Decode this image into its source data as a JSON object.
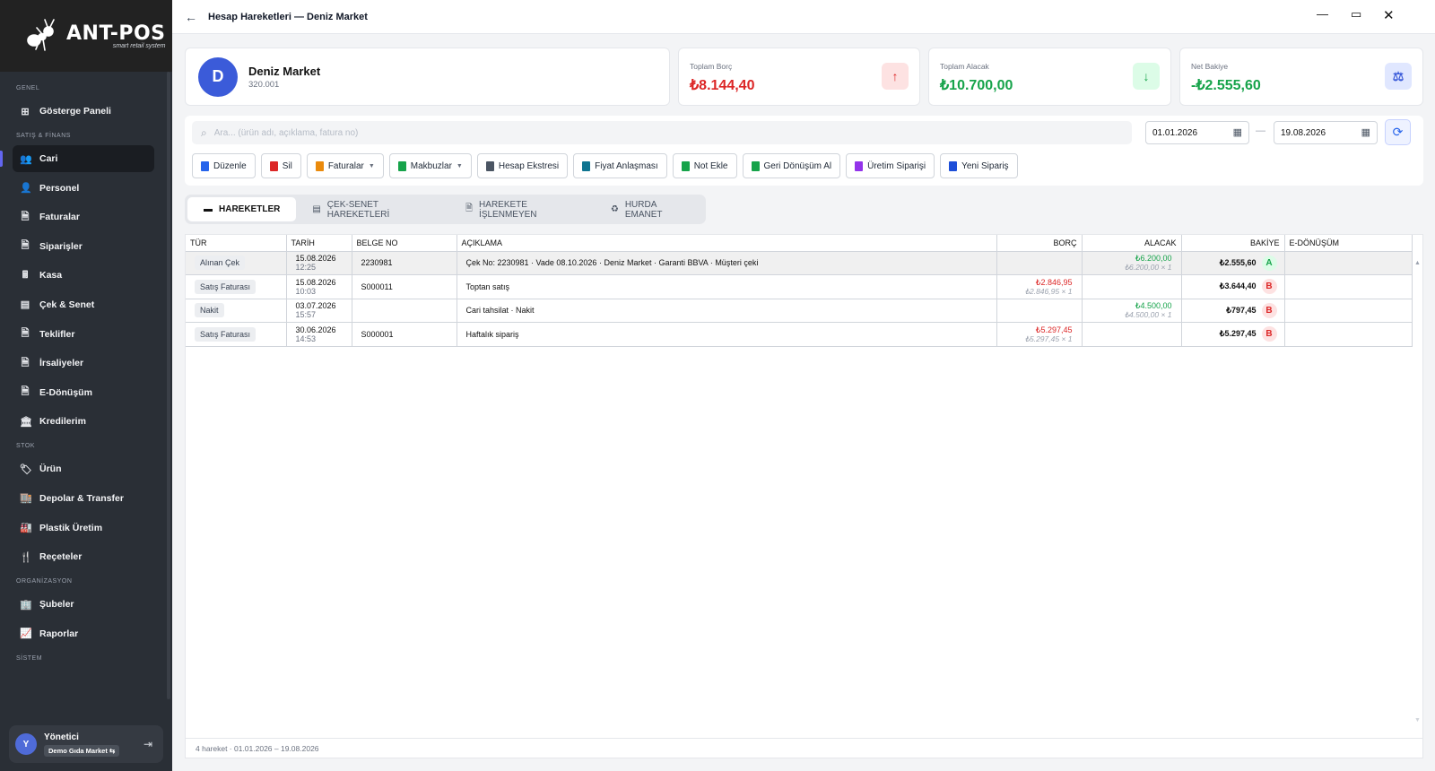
{
  "app": {
    "logo_name": "ANT-POS",
    "logo_tagline": "smart retail system"
  },
  "sidebar": {
    "sections": [
      {
        "label": "GENEL",
        "items": [
          {
            "label": "Gösterge Paneli",
            "icon": "dashboard-icon",
            "glyph": "⊞"
          }
        ]
      },
      {
        "label": "SATIŞ & FİNANS",
        "items": [
          {
            "label": "Cari",
            "icon": "users-icon",
            "glyph": "👥",
            "active": true
          },
          {
            "label": "Personel",
            "icon": "user-cog-icon",
            "glyph": "👤"
          },
          {
            "label": "Faturalar",
            "icon": "invoice-icon",
            "glyph": "🗎"
          },
          {
            "label": "Siparişler",
            "icon": "order-icon",
            "glyph": "🗎"
          },
          {
            "label": "Kasa",
            "icon": "cash-register-icon",
            "glyph": "🖩"
          },
          {
            "label": "Çek & Senet",
            "icon": "cheque-icon",
            "glyph": "▤"
          },
          {
            "label": "Teklifler",
            "icon": "offer-icon",
            "glyph": "🗎"
          },
          {
            "label": "İrsaliyeler",
            "icon": "waybill-icon",
            "glyph": "🗎"
          },
          {
            "label": "E-Dönüşüm",
            "icon": "e-invoice-icon",
            "glyph": "🗎"
          },
          {
            "label": "Kredilerim",
            "icon": "bank-icon",
            "glyph": "🏛"
          }
        ]
      },
      {
        "label": "STOK",
        "items": [
          {
            "label": "Ürün",
            "icon": "tag-icon",
            "glyph": "🏷"
          },
          {
            "label": "Depolar & Transfer",
            "icon": "warehouse-icon",
            "glyph": "🏬"
          },
          {
            "label": "Plastik Üretim",
            "icon": "factory-icon",
            "glyph": "🏭"
          },
          {
            "label": "Reçeteler",
            "icon": "utensils-icon",
            "glyph": "🍴"
          }
        ]
      },
      {
        "label": "ORGANİZASYON",
        "items": [
          {
            "label": "Şubeler",
            "icon": "branch-icon",
            "glyph": "🏢"
          },
          {
            "label": "Raporlar",
            "icon": "chart-line-icon",
            "glyph": "📈"
          }
        ]
      },
      {
        "label": "SİSTEM",
        "items": []
      }
    ],
    "user": {
      "initial": "Y",
      "name": "Yönetici",
      "company": "Demo Gıda Market",
      "switch_glyph": "⇆",
      "logout_glyph": "⇥"
    }
  },
  "topbar": {
    "title": "Hesap Hareketleri — Deniz Market",
    "back_glyph": "←",
    "min_glyph": "—",
    "max_glyph": "▭",
    "close_glyph": "✕"
  },
  "customer": {
    "initial": "D",
    "name": "Deniz Market",
    "code": "320.001"
  },
  "stats": {
    "debt": {
      "label": "Toplam Borç",
      "value": "₺8.144,40",
      "glyph": "↑",
      "color": "#dc2626"
    },
    "credit": {
      "label": "Toplam Alacak",
      "value": "₺10.700,00",
      "glyph": "↓",
      "color": "#16a34a"
    },
    "net": {
      "label": "Net Bakiye",
      "value": "-₺2.555,60",
      "glyph": "⚖",
      "color": "#16a34a"
    }
  },
  "search": {
    "placeholder": "Ara... (ürün adı, açıklama, fatura no)",
    "value": ""
  },
  "date_from": "01.01.2026",
  "date_to": "19.08.2026",
  "date_sep": "—",
  "refresh_glyph": "⟳",
  "calendar_glyph": "▦",
  "search_glyph": "⌕",
  "actions": [
    {
      "label": "Düzenle",
      "name": "edit-button",
      "icon": "edit-icon",
      "color": "#2563eb",
      "dd": false
    },
    {
      "label": "Sil",
      "name": "delete-button",
      "icon": "trash-icon",
      "color": "#dc2626",
      "dd": false
    },
    {
      "label": "Faturalar",
      "name": "invoices-button",
      "icon": "invoice-icon",
      "color": "#ea8a0c",
      "dd": true
    },
    {
      "label": "Makbuzlar",
      "name": "receipts-button",
      "icon": "receipt-icon",
      "color": "#16a34a",
      "dd": true
    },
    {
      "label": "Hesap Ekstresi",
      "name": "statement-button",
      "icon": "file-icon",
      "color": "#4b5563",
      "dd": false
    },
    {
      "label": "Fiyat Anlaşması",
      "name": "price-agreement-button",
      "icon": "handshake-icon",
      "color": "#0e7490",
      "dd": false
    },
    {
      "label": "Not Ekle",
      "name": "add-note-button",
      "icon": "note-icon",
      "color": "#16a34a",
      "dd": false
    },
    {
      "label": "Geri Dönüşüm Al",
      "name": "recycle-button",
      "icon": "recycle-icon",
      "color": "#16a34a",
      "dd": false
    },
    {
      "label": "Üretim Siparişi",
      "name": "production-order-button",
      "icon": "factory-icon",
      "color": "#9333ea",
      "dd": false
    },
    {
      "label": "Yeni Sipariş",
      "name": "new-order-button",
      "icon": "clipboard-icon",
      "color": "#1d4ed8",
      "dd": false
    }
  ],
  "tabs": [
    {
      "label": "HAREKETLER",
      "icon": "folder-icon",
      "glyph": "▬",
      "active": true
    },
    {
      "label": "ÇEK-SENET HAREKETLERİ",
      "icon": "cheque-icon",
      "glyph": "▤",
      "active": false
    },
    {
      "label": "HAREKETE İŞLENMEYEN",
      "icon": "file-icon",
      "glyph": "🗎",
      "active": false
    },
    {
      "label": "HURDA EMANET",
      "icon": "recycle-icon",
      "glyph": "♻",
      "active": false
    }
  ],
  "table": {
    "columns": [
      "TÜR",
      "TARİH",
      "BELGE NO",
      "AÇIKLAMA",
      "BORÇ",
      "ALACAK",
      "BAKİYE",
      "E-DÖNÜŞÜM"
    ],
    "rows": [
      {
        "type": "Alınan Çek",
        "date": "15.08.2026",
        "time": "12:25",
        "doc": "2230981",
        "desc": "Çek No: 2230981 · Vade 08.10.2026 · Deniz Market · Garanti BBVA · Müşteri çeki",
        "debt": "",
        "debt_sub": "",
        "credit": "₺6.200,00",
        "credit_sub": "₺6.200,00 × 1",
        "balance": "₺2.555,60",
        "badge": "A",
        "selected": true
      },
      {
        "type": "Satış Faturası",
        "date": "15.08.2026",
        "time": "10:03",
        "doc": "S000011",
        "desc": "Toptan satış",
        "debt": "₺2.846,95",
        "debt_sub": "₺2.846,95 × 1",
        "credit": "",
        "credit_sub": "",
        "balance": "₺3.644,40",
        "badge": "B"
      },
      {
        "type": "Nakit",
        "date": "03.07.2026",
        "time": "15:57",
        "doc": "",
        "desc": "Cari tahsilat · Nakit",
        "debt": "",
        "debt_sub": "",
        "credit": "₺4.500,00",
        "credit_sub": "₺4.500,00 × 1",
        "balance": "₺797,45",
        "badge": "B"
      },
      {
        "type": "Satış Faturası",
        "date": "30.06.2026",
        "time": "14:53",
        "doc": "S000001",
        "desc": "Haftalık sipariş",
        "debt": "₺5.297,45",
        "debt_sub": "₺5.297,45 × 1",
        "credit": "",
        "credit_sub": "",
        "balance": "₺5.297,45",
        "badge": "B"
      }
    ]
  },
  "footer": "4 hareket · 01.01.2026 – 19.08.2026"
}
